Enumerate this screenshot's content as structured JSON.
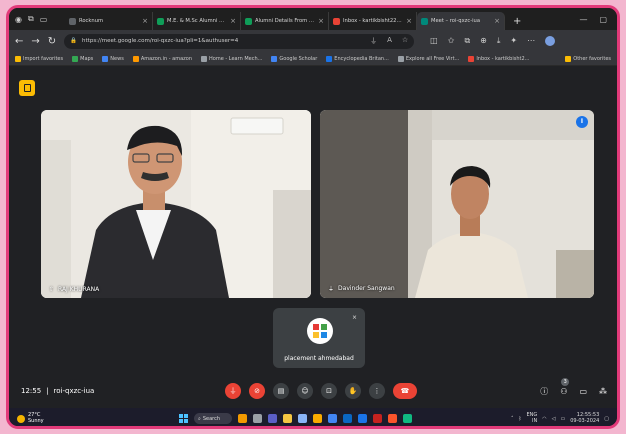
{
  "browser": {
    "tabs": [
      {
        "title": "Rocknum",
        "color": "#5f6368"
      },
      {
        "title": "M.E. & M.Sc Alumni Data C",
        "color": "#0f9d58"
      },
      {
        "title": "Alumni Details From LinkedIn",
        "color": "#0f9d58"
      },
      {
        "title": "Inbox - kartikbisht2216@gm",
        "color": "#ea4335"
      },
      {
        "title": "Meet – roi-qxzc-iua",
        "color": "#00897b",
        "active": true
      }
    ],
    "url": "https://meet.google.com/roi-qxzc-iua?pli=1&authuser=4",
    "bookmarks": [
      {
        "label": "Import favorites",
        "color": "#fbbc04"
      },
      {
        "label": "Maps",
        "color": "#34a853"
      },
      {
        "label": "News",
        "color": "#4285f4"
      },
      {
        "label": "Amazon.in - amazon",
        "color": "#ff9900"
      },
      {
        "label": "Home - Learn Mech...",
        "color": "#9aa0a6"
      },
      {
        "label": "Google Scholar",
        "color": "#4285f4"
      },
      {
        "label": "Encyclopedia Britan...",
        "color": "#1a73e8"
      },
      {
        "label": "Explore all Free Virt...",
        "color": "#9aa0a6"
      },
      {
        "label": "Inbox - kartikbisht2...",
        "color": "#ea4335"
      }
    ],
    "other_favorites": "Other favorites"
  },
  "meet": {
    "participants": [
      {
        "name": "RAJ KHURANA"
      },
      {
        "name": "Davinder Sangwan"
      },
      {
        "name": "placement ahmedabad"
      }
    ],
    "meeting_time": "12:55",
    "meeting_code": "roi-qxzc-iua",
    "people_count": "3"
  },
  "taskbar": {
    "temperature": "27°C",
    "weather": "Sunny",
    "search_label": "Search",
    "lang": "ENG",
    "region": "IN",
    "time": "12:55:53",
    "date": "09-03-2024"
  }
}
